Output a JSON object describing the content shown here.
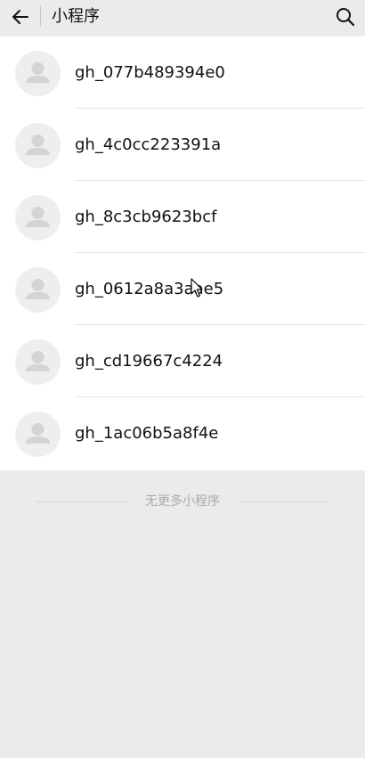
{
  "header": {
    "back_icon": "arrow-left-icon",
    "title": "小程序",
    "search_icon": "search-icon"
  },
  "mini_programs": [
    {
      "name": "gh_077b489394e0",
      "avatar": "default-user-icon"
    },
    {
      "name": "gh_4c0cc223391a",
      "avatar": "default-user-icon"
    },
    {
      "name": "gh_8c3cb9623bcf",
      "avatar": "default-user-icon"
    },
    {
      "name": "gh_0612a8a3aae5",
      "avatar": "default-user-icon"
    },
    {
      "name": "gh_cd19667c4224",
      "avatar": "default-user-icon"
    },
    {
      "name": "gh_1ac06b5a8f4e",
      "avatar": "default-user-icon"
    }
  ],
  "footer": {
    "text": "无更多小程序"
  },
  "colors": {
    "background": "#ebebeb",
    "list_background": "#ffffff",
    "avatar_background": "#eeeeee",
    "avatar_glyph": "#d4d4d4"
  }
}
